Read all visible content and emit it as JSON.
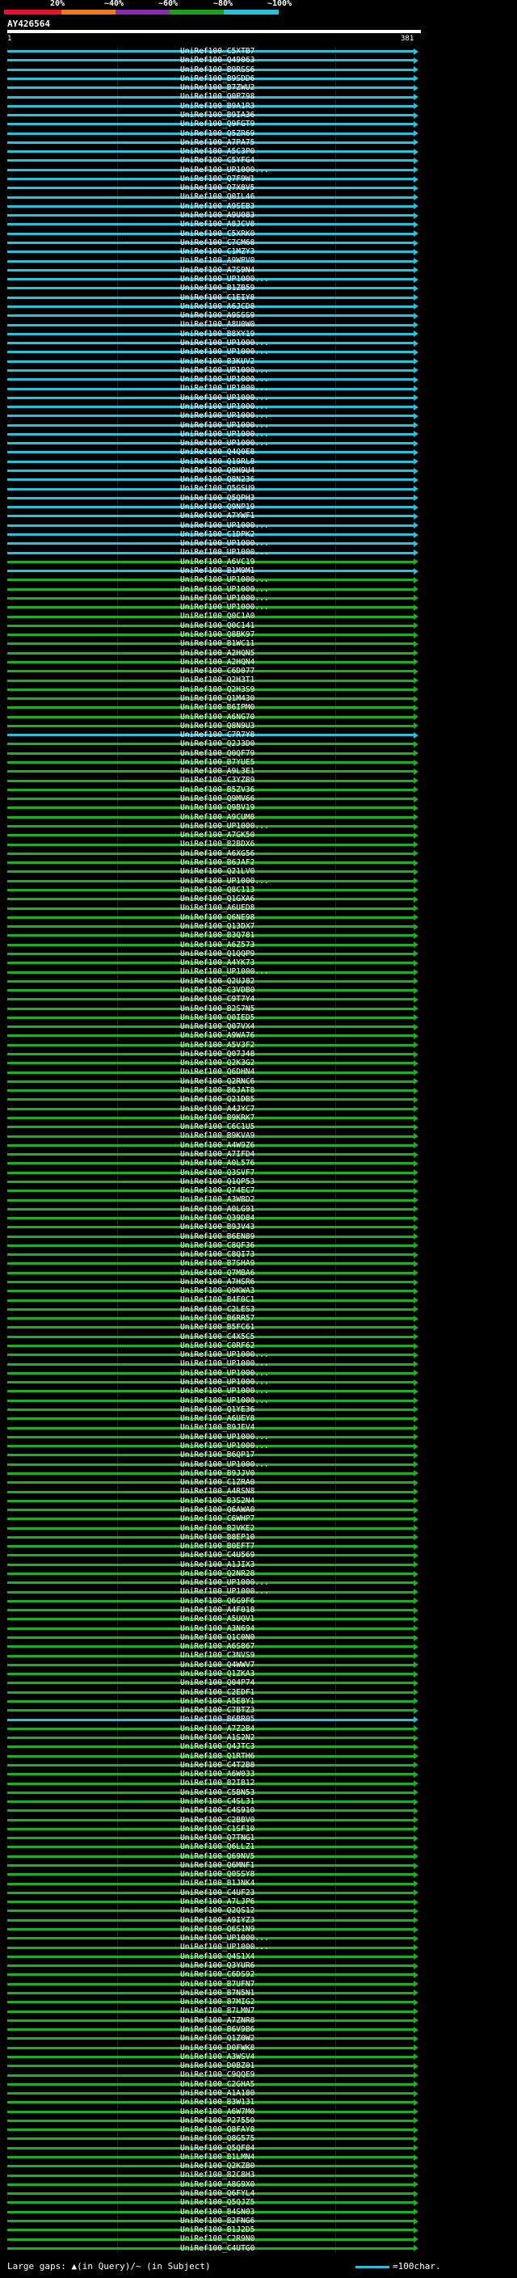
{
  "scale": {
    "labels": [
      "20%",
      "~40%",
      "~60%",
      "~80%",
      "~100%"
    ],
    "colors": [
      "#e8102b",
      "#f07a1a",
      "#8a2ab0",
      "#1ca01c",
      "#27c1d9"
    ]
  },
  "query": {
    "title": "AY426564",
    "start": "1",
    "end": "381"
  },
  "colors": {
    "cyan": "#27c1d9",
    "green": "#1fae1f",
    "gap": "#ffffff"
  },
  "hits": [
    {
      "label": "UniRef100_C5XTB7",
      "c": "c"
    },
    {
      "label": "UniRef100_Q49063",
      "c": "c"
    },
    {
      "label": "UniRef100_B9RSS6",
      "c": "c"
    },
    {
      "label": "UniRef100_B9SDD6",
      "c": "c"
    },
    {
      "label": "UniRef100_B7ZWU2",
      "c": "c"
    },
    {
      "label": "UniRef100_Q0P798",
      "c": "c"
    },
    {
      "label": "UniRef100_B9A1R3",
      "c": "c"
    },
    {
      "label": "UniRef100_B9IA36",
      "c": "c"
    },
    {
      "label": "UniRef100_Q9FGT9",
      "c": "c"
    },
    {
      "label": "UniRef100_Q5ZR69",
      "c": "c"
    },
    {
      "label": "UniRef100_A7PA75",
      "c": "c"
    },
    {
      "label": "UniRef100_A5C3P0",
      "c": "c"
    },
    {
      "label": "UniRef100_C5YFG4",
      "c": "c"
    },
    {
      "label": "UniRef100_UP1000...",
      "c": "c"
    },
    {
      "label": "UniRef100_Q7F9W1",
      "c": "c"
    },
    {
      "label": "UniRef100_Q7X8V5",
      "c": "c"
    },
    {
      "label": "UniRef100_Q0IL46",
      "c": "c"
    },
    {
      "label": "UniRef100_A9SEB3",
      "c": "c"
    },
    {
      "label": "UniRef100_A9U083",
      "c": "c"
    },
    {
      "label": "UniRef100_A8JCV8",
      "c": "c"
    },
    {
      "label": "UniRef100_C5XRK0",
      "c": "c"
    },
    {
      "label": "UniRef100_C7CM68",
      "c": "c"
    },
    {
      "label": "UniRef100_C1MZY3",
      "c": "c"
    },
    {
      "label": "UniRef100_A9WPV0",
      "c": "c"
    },
    {
      "label": "UniRef100_A7S9N4",
      "c": "c"
    },
    {
      "label": "UniRef100_UP1000...",
      "c": "c"
    },
    {
      "label": "UniRef100_B1ZB59",
      "c": "c"
    },
    {
      "label": "UniRef100_C1EIY8",
      "c": "c"
    },
    {
      "label": "UniRef100_A6JCD8",
      "c": "c"
    },
    {
      "label": "UniRef100_A9SSS9",
      "c": "c"
    },
    {
      "label": "UniRef100_A8U0W0",
      "c": "c"
    },
    {
      "label": "UniRef100_B8XY19",
      "c": "c"
    },
    {
      "label": "UniRef100_UP1000...",
      "c": "c"
    },
    {
      "label": "UniRef100_UP1000...",
      "c": "c"
    },
    {
      "label": "UniRef100_B3KUV2",
      "c": "c"
    },
    {
      "label": "UniRef100_UP1000...",
      "c": "c"
    },
    {
      "label": "UniRef100_UP1000...",
      "c": "c"
    },
    {
      "label": "UniRef100_UP1000...",
      "c": "c"
    },
    {
      "label": "UniRef100_UP1000...",
      "c": "c"
    },
    {
      "label": "UniRef100_UP1000...",
      "c": "c"
    },
    {
      "label": "UniRef100_UP1000...",
      "c": "c"
    },
    {
      "label": "UniRef100_UP1000...",
      "c": "c"
    },
    {
      "label": "UniRef100_UP1000...",
      "c": "c"
    },
    {
      "label": "UniRef100_UP1000...",
      "c": "c"
    },
    {
      "label": "UniRef100_Q4Q0E8",
      "c": "c"
    },
    {
      "label": "UniRef100_Q19RL8",
      "c": "c"
    },
    {
      "label": "UniRef100_Q9H9U4",
      "c": "c"
    },
    {
      "label": "UniRef100_Q8N236",
      "c": "c"
    },
    {
      "label": "UniRef100_Q5GSU9",
      "c": "c"
    },
    {
      "label": "UniRef100_Q5QPH3",
      "c": "c"
    },
    {
      "label": "UniRef100_Q9NP19",
      "c": "c"
    },
    {
      "label": "UniRef100_A7YWF1",
      "c": "c"
    },
    {
      "label": "UniRef100_UP1000...",
      "c": "c"
    },
    {
      "label": "UniRef100_C1DPK2",
      "c": "c"
    },
    {
      "label": "UniRef100_UP1000...",
      "c": "c"
    },
    {
      "label": "UniRef100_UP1000...",
      "c": "c"
    },
    {
      "label": "UniRef100_A6VC19",
      "c": "g"
    },
    {
      "label": "UniRef100_B1M9M1",
      "c": "c"
    },
    {
      "label": "UniRef100_UP1000...",
      "c": "g"
    },
    {
      "label": "UniRef100_UP1000...",
      "c": "g"
    },
    {
      "label": "UniRef100_UP1000...",
      "c": "g"
    },
    {
      "label": "UniRef100_UP1000...",
      "c": "g"
    },
    {
      "label": "UniRef100_Q0C1A0",
      "c": "g"
    },
    {
      "label": "UniRef100_Q0C141",
      "c": "g"
    },
    {
      "label": "UniRef100_Q8BK97",
      "c": "g"
    },
    {
      "label": "UniRef100_B1WC11",
      "c": "g"
    },
    {
      "label": "UniRef100_A2HQN5",
      "c": "g"
    },
    {
      "label": "UniRef100_A2HQN4",
      "c": "g"
    },
    {
      "label": "UniRef100_C6D077",
      "c": "g"
    },
    {
      "label": "UniRef100_Q2H3T1",
      "c": "g"
    },
    {
      "label": "UniRef100_Q2H3S9",
      "c": "g"
    },
    {
      "label": "UniRef100_Q1M430",
      "c": "g"
    },
    {
      "label": "UniRef100_B6IPM0",
      "c": "g"
    },
    {
      "label": "UniRef100_A6NG70",
      "c": "g"
    },
    {
      "label": "UniRef100_Q8N9U3",
      "c": "g"
    },
    {
      "label": "UniRef100_C7R7Y8",
      "c": "c"
    },
    {
      "label": "UniRef100_Q2J3D0",
      "c": "g"
    },
    {
      "label": "UniRef100_Q0QF79",
      "c": "g"
    },
    {
      "label": "UniRef100_B7YUE5",
      "c": "g"
    },
    {
      "label": "UniRef100_A9L3E1",
      "c": "g"
    },
    {
      "label": "UniRef100_C3YZB9",
      "c": "g"
    },
    {
      "label": "UniRef100_B5ZV36",
      "c": "g"
    },
    {
      "label": "UniRef100_Q9MV66",
      "c": "g"
    },
    {
      "label": "UniRef100_Q9BV19",
      "c": "g"
    },
    {
      "label": "UniRef100_A9CUM8",
      "c": "g"
    },
    {
      "label": "UniRef100_UP1000...",
      "c": "g"
    },
    {
      "label": "UniRef100_A7GK50",
      "c": "g"
    },
    {
      "label": "UniRef100_B2BDX6",
      "c": "g"
    },
    {
      "label": "UniRef100_A6XG56",
      "c": "g"
    },
    {
      "label": "UniRef100_B6JAF2",
      "c": "g"
    },
    {
      "label": "UniRef100_Q21LV0",
      "c": "g"
    },
    {
      "label": "UniRef100_UP1000...",
      "c": "g"
    },
    {
      "label": "UniRef100_Q8C113",
      "c": "g"
    },
    {
      "label": "UniRef100_Q1GXA6",
      "c": "g"
    },
    {
      "label": "UniRef100_A6UED8",
      "c": "g"
    },
    {
      "label": "UniRef100_Q6NE98",
      "c": "g"
    },
    {
      "label": "UniRef100_Q13DX7",
      "c": "g"
    },
    {
      "label": "UniRef100_B3Q781",
      "c": "g"
    },
    {
      "label": "UniRef100_A6Z573",
      "c": "g"
    },
    {
      "label": "UniRef100_Q1QQP9",
      "c": "g"
    },
    {
      "label": "UniRef100_A4YK73",
      "c": "g"
    },
    {
      "label": "UniRef100_UP1000...",
      "c": "g"
    },
    {
      "label": "UniRef100_Q2UJ82",
      "c": "g"
    },
    {
      "label": "UniRef100_C3VDB0",
      "c": "g"
    },
    {
      "label": "UniRef100_C9T7Y4",
      "c": "g"
    },
    {
      "label": "UniRef100_B2S7N5",
      "c": "g"
    },
    {
      "label": "UniRef100_Q0IED5",
      "c": "g"
    },
    {
      "label": "UniRef100_Q07VX4",
      "c": "g"
    },
    {
      "label": "UniRef100_A9WA76",
      "c": "g"
    },
    {
      "label": "UniRef100_A5V3F2",
      "c": "g"
    },
    {
      "label": "UniRef100_Q07J48",
      "c": "g"
    },
    {
      "label": "UniRef100_Q2K3G2",
      "c": "g"
    },
    {
      "label": "UniRef100_Q6DHN4",
      "c": "g"
    },
    {
      "label": "UniRef100_Q2RNC6",
      "c": "g"
    },
    {
      "label": "UniRef100_B6JAT8",
      "c": "g"
    },
    {
      "label": "UniRef100_Q21DB5",
      "c": "g"
    },
    {
      "label": "UniRef100_A4JYC7",
      "c": "g"
    },
    {
      "label": "UniRef100_B9KRK7",
      "c": "g"
    },
    {
      "label": "UniRef100_C6C1U5",
      "c": "g"
    },
    {
      "label": "UniRef100_B9KVA9",
      "c": "g"
    },
    {
      "label": "UniRef100_A4W9Z6",
      "c": "g"
    },
    {
      "label": "UniRef100_A7IFD4",
      "c": "g"
    },
    {
      "label": "UniRef100_A0L576",
      "c": "g"
    },
    {
      "label": "UniRef100_Q3SVF7",
      "c": "g"
    },
    {
      "label": "UniRef100_Q1QP53",
      "c": "g"
    },
    {
      "label": "UniRef100_Q74EC7",
      "c": "g"
    },
    {
      "label": "UniRef100_A3WBD2",
      "c": "g"
    },
    {
      "label": "UniRef100_A0LG91",
      "c": "g"
    },
    {
      "label": "UniRef100_Q39D84",
      "c": "g"
    },
    {
      "label": "UniRef100_B9JV43",
      "c": "g"
    },
    {
      "label": "UniRef100_B6EN89",
      "c": "g"
    },
    {
      "label": "UniRef100_C8QF36",
      "c": "g"
    },
    {
      "label": "UniRef100_C8QI73",
      "c": "g"
    },
    {
      "label": "UniRef100_B7SHA9",
      "c": "g"
    },
    {
      "label": "UniRef100_Q7MBA6",
      "c": "g"
    },
    {
      "label": "UniRef100_A7HSR6",
      "c": "g"
    },
    {
      "label": "UniRef100_Q9KWA3",
      "c": "g"
    },
    {
      "label": "UniRef100_B4F0C1",
      "c": "g"
    },
    {
      "label": "UniRef100_C2LES3",
      "c": "g"
    },
    {
      "label": "UniRef100_B6RR57",
      "c": "g"
    },
    {
      "label": "UniRef100_B5FC61",
      "c": "g"
    },
    {
      "label": "UniRef100_C4X5C5",
      "c": "g"
    },
    {
      "label": "UniRef100_C0RF62",
      "c": "g"
    },
    {
      "label": "UniRef100_UP1000...",
      "c": "g"
    },
    {
      "label": "UniRef100_UP1000...",
      "c": "g"
    },
    {
      "label": "UniRef100_UP1000...",
      "c": "g"
    },
    {
      "label": "UniRef100_UP1000...",
      "c": "g"
    },
    {
      "label": "UniRef100_UP1000...",
      "c": "g"
    },
    {
      "label": "UniRef100_UP1000...",
      "c": "g"
    },
    {
      "label": "UniRef100_Q1YE36",
      "c": "g"
    },
    {
      "label": "UniRef100_A6UEY8",
      "c": "g"
    },
    {
      "label": "UniRef100_B9JEV4",
      "c": "g"
    },
    {
      "label": "UniRef100_UP1000...",
      "c": "g"
    },
    {
      "label": "UniRef100_UP1000...",
      "c": "g"
    },
    {
      "label": "UniRef100_B6QP17",
      "c": "g"
    },
    {
      "label": "UniRef100_UP1000...",
      "c": "g"
    },
    {
      "label": "UniRef100_B9JJV0",
      "c": "g"
    },
    {
      "label": "UniRef100_C1ZRA0",
      "c": "g"
    },
    {
      "label": "UniRef100_A4RSN8",
      "c": "g"
    },
    {
      "label": "UniRef100_B3S2N4",
      "c": "g"
    },
    {
      "label": "UniRef100_Q6AWA0",
      "c": "g"
    },
    {
      "label": "UniRef100_C6WHP7",
      "c": "g"
    },
    {
      "label": "UniRef100_B2VKE2",
      "c": "g"
    },
    {
      "label": "UniRef100_B8EP10",
      "c": "g"
    },
    {
      "label": "UniRef100_B0EFT7",
      "c": "g"
    },
    {
      "label": "UniRef100_C4U569",
      "c": "g"
    },
    {
      "label": "UniRef100_A1JIX3",
      "c": "g"
    },
    {
      "label": "UniRef100_Q2NR28",
      "c": "g"
    },
    {
      "label": "UniRef100_UP1000...",
      "c": "g"
    },
    {
      "label": "UniRef100_UP1000...",
      "c": "g"
    },
    {
      "label": "UniRef100_Q6G9F6",
      "c": "g"
    },
    {
      "label": "UniRef100_A4F018",
      "c": "g"
    },
    {
      "label": "UniRef100_A5UQV1",
      "c": "g"
    },
    {
      "label": "UniRef100_A3N694",
      "c": "g"
    },
    {
      "label": "UniRef100_Q1C0N0",
      "c": "g"
    },
    {
      "label": "UniRef100_A6S867",
      "c": "g"
    },
    {
      "label": "UniRef100_C3NVS9",
      "c": "g"
    },
    {
      "label": "UniRef100_Q4WWV7",
      "c": "g"
    },
    {
      "label": "UniRef100_Q1ZKA3",
      "c": "g"
    },
    {
      "label": "UniRef100_Q04P74",
      "c": "g"
    },
    {
      "label": "UniRef100_C2EDF1",
      "c": "g"
    },
    {
      "label": "UniRef100_A5E8Y1",
      "c": "g"
    },
    {
      "label": "UniRef100_C7BTZ3",
      "c": "g"
    },
    {
      "label": "UniRef100_B6BR05",
      "c": "c"
    },
    {
      "label": "UniRef100_A7Z2B4",
      "c": "g"
    },
    {
      "label": "UniRef100_A1S2N2",
      "c": "g"
    },
    {
      "label": "UniRef100_Q4JTC3",
      "c": "g"
    },
    {
      "label": "UniRef100_Q1RTH6",
      "c": "g"
    },
    {
      "label": "UniRef100_C4T2B8",
      "c": "g"
    },
    {
      "label": "UniRef100_A6W033",
      "c": "g"
    },
    {
      "label": "UniRef100_B2IB12",
      "c": "g"
    },
    {
      "label": "UniRef100_C5BN53",
      "c": "g"
    },
    {
      "label": "UniRef100_C4SL31",
      "c": "g"
    },
    {
      "label": "UniRef100_C4S910",
      "c": "g"
    },
    {
      "label": "UniRef100_C2BBV0",
      "c": "g"
    },
    {
      "label": "UniRef100_C1SF10",
      "c": "g"
    },
    {
      "label": "UniRef100_Q7TNG1",
      "c": "g"
    },
    {
      "label": "UniRef100_Q6LLZ1",
      "c": "g"
    },
    {
      "label": "UniRef100_Q69NV5",
      "c": "g"
    },
    {
      "label": "UniRef100_Q6MNF1",
      "c": "g"
    },
    {
      "label": "UniRef100_Q0SSY8",
      "c": "g"
    },
    {
      "label": "UniRef100_B1JNK4",
      "c": "g"
    },
    {
      "label": "UniRef100_C4UF23",
      "c": "g"
    },
    {
      "label": "UniRef100_A7LJP6",
      "c": "g"
    },
    {
      "label": "UniRef100_Q2QS12",
      "c": "g"
    },
    {
      "label": "UniRef100_A9IYZ3",
      "c": "g"
    },
    {
      "label": "UniRef100_Q6S1N9",
      "c": "g"
    },
    {
      "label": "UniRef100_UP1000...",
      "c": "g"
    },
    {
      "label": "UniRef100_UP1000...",
      "c": "g"
    },
    {
      "label": "UniRef100_Q4S1X4",
      "c": "g"
    },
    {
      "label": "UniRef100_Q3YUR6",
      "c": "g"
    },
    {
      "label": "UniRef100_C6DS92",
      "c": "g"
    },
    {
      "label": "UniRef100_B7UFN7",
      "c": "g"
    },
    {
      "label": "UniRef100_B7N5N1",
      "c": "g"
    },
    {
      "label": "UniRef100_B7MIG2",
      "c": "g"
    },
    {
      "label": "UniRef100_B7LMN7",
      "c": "g"
    },
    {
      "label": "UniRef100_A7ZNR8",
      "c": "g"
    },
    {
      "label": "UniRef100_B6V9B6",
      "c": "g"
    },
    {
      "label": "UniRef100_Q1Z0W2",
      "c": "g"
    },
    {
      "label": "UniRef100_D0FWK8",
      "c": "g"
    },
    {
      "label": "UniRef100_A3WSV4",
      "c": "g"
    },
    {
      "label": "UniRef100_D0BZ01",
      "c": "g"
    },
    {
      "label": "UniRef100_C9QQE9",
      "c": "g"
    },
    {
      "label": "UniRef100_C2GHA5",
      "c": "g"
    },
    {
      "label": "UniRef100_A1A180",
      "c": "g"
    },
    {
      "label": "UniRef100_B3W131",
      "c": "g"
    },
    {
      "label": "UniRef100_A6W7M0",
      "c": "g"
    },
    {
      "label": "UniRef100_P27550",
      "c": "g"
    },
    {
      "label": "UniRef100_Q8FAY8",
      "c": "g"
    },
    {
      "label": "UniRef100_Q8G575",
      "c": "g"
    },
    {
      "label": "UniRef100_Q5QF84",
      "c": "g"
    },
    {
      "label": "UniRef100_B1LMN4",
      "c": "g"
    },
    {
      "label": "UniRef100_Q2KZB0",
      "c": "g"
    },
    {
      "label": "UniRef100_B2C8H3",
      "c": "g"
    },
    {
      "label": "UniRef100_A8G9X0",
      "c": "g"
    },
    {
      "label": "UniRef100_Q6FYL4",
      "c": "g"
    },
    {
      "label": "UniRef100_Q5QJZ5",
      "c": "g"
    },
    {
      "label": "UniRef100_B4SN03",
      "c": "g"
    },
    {
      "label": "UniRef100_B2FNG6",
      "c": "g"
    },
    {
      "label": "UniRef100_B1J2D5",
      "c": "g"
    },
    {
      "label": "UniRef100_C2R9N0",
      "c": "g"
    },
    {
      "label": "UniRef100_C4UTG0",
      "c": "g"
    }
  ],
  "footer": {
    "text": "Large gaps: ▲(in Query)/~ (in Subject)"
  },
  "legend": {
    "text": "=100char."
  }
}
